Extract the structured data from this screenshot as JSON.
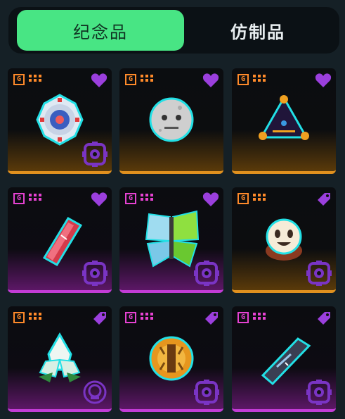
{
  "tabs": {
    "souvenir": "纪念品",
    "replica": "仿制品"
  },
  "badge_letter": "G",
  "colors": {
    "orange": "#ff8a2a",
    "purple": "#e642d2",
    "heart": "#9b3fdd",
    "tab_active": "#48e584"
  },
  "cards": [
    {
      "item_icon": "spinning-disc-icon",
      "rarity": "orange",
      "favorite": "heart-icon"
    },
    {
      "item_icon": "moon-face-icon",
      "rarity": "orange",
      "favorite": "heart-icon"
    },
    {
      "item_icon": "triangle-gem-icon",
      "rarity": "orange",
      "favorite": "heart-icon"
    },
    {
      "item_icon": "red-crystal-icon",
      "rarity": "purple",
      "favorite": "heart-icon"
    },
    {
      "item_icon": "butterfly-icon",
      "rarity": "purple",
      "favorite": "heart-icon"
    },
    {
      "item_icon": "smiling-mask-icon",
      "rarity": "orange",
      "favorite": "tag-icon"
    },
    {
      "item_icon": "white-crystal-flower-icon",
      "rarity": "purple",
      "favorite": "tag-icon"
    },
    {
      "item_icon": "amber-fruit-icon",
      "rarity": "purple",
      "favorite": "tag-icon"
    },
    {
      "item_icon": "dark-blade-icon",
      "rarity": "purple",
      "favorite": "tag-icon"
    }
  ]
}
